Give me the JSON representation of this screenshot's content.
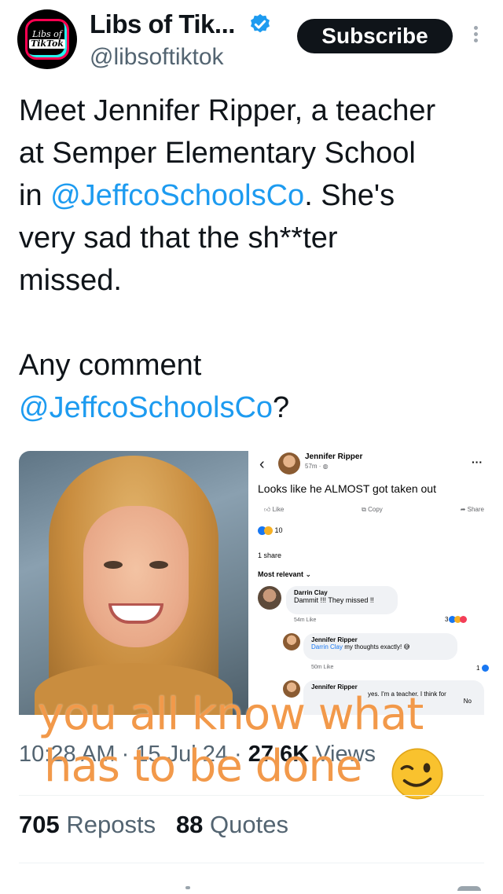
{
  "header": {
    "display_name": "Libs of Tik...",
    "handle": "@libsoftiktok",
    "subscribe_label": "Subscribe",
    "avatar_text_line1": "Libs of",
    "avatar_text_line2": "TikTok"
  },
  "tweet": {
    "line1": "Meet Jennifer Ripper, a teacher",
    "line2": "at Semper Elementary School",
    "line3_prefix": "in ",
    "line3_mention": "@JeffcoSchoolsCo",
    "line3_suffix": ". She's",
    "line4": "very sad that the sh**ter",
    "line5": "missed.",
    "line6": "Any comment",
    "line7_mention": "@JeffcoSchoolsCo",
    "line7_suffix": "?"
  },
  "fb_screenshot": {
    "author": "Jennifer Ripper",
    "time": "57m · ",
    "post_text": "Looks like he ALMOST got taken out",
    "like_label": "Like",
    "copy_label": "Copy",
    "share_label": "Share",
    "reaction_count": "10",
    "share_count": "1 share",
    "sort_label": "Most relevant",
    "comment1_author": "Darrin Clay",
    "comment1_text": "Dammit !!! They missed !!",
    "comment1_meta": "54m    Like",
    "comment1_reactions": "3",
    "comment2_author": "Jennifer Ripper",
    "comment2_link": "Darrin Clay",
    "comment2_text": " my thoughts exactly!",
    "comment2_meta": "50m    Like",
    "comment2_reactions": "1",
    "comment3_author": "Jennifer Ripper",
    "comment3_text": "yes. I'm a teacher. I think for",
    "comment3_tail": "No"
  },
  "overlay": {
    "line1": "you all know what",
    "line2": "has to be done"
  },
  "meta": {
    "time": "10:28 AM · 15 Jul 24 · ",
    "views_count": "27.6K",
    "views_label": " Views"
  },
  "stats": {
    "reposts_count": "705",
    "reposts_label": "Reposts",
    "quotes_count": "88",
    "quotes_label": "Quotes"
  },
  "colors": {
    "accent": "#1d9bf0",
    "caption": "#f2994a",
    "text": "#0f1419",
    "muted": "#536471"
  }
}
